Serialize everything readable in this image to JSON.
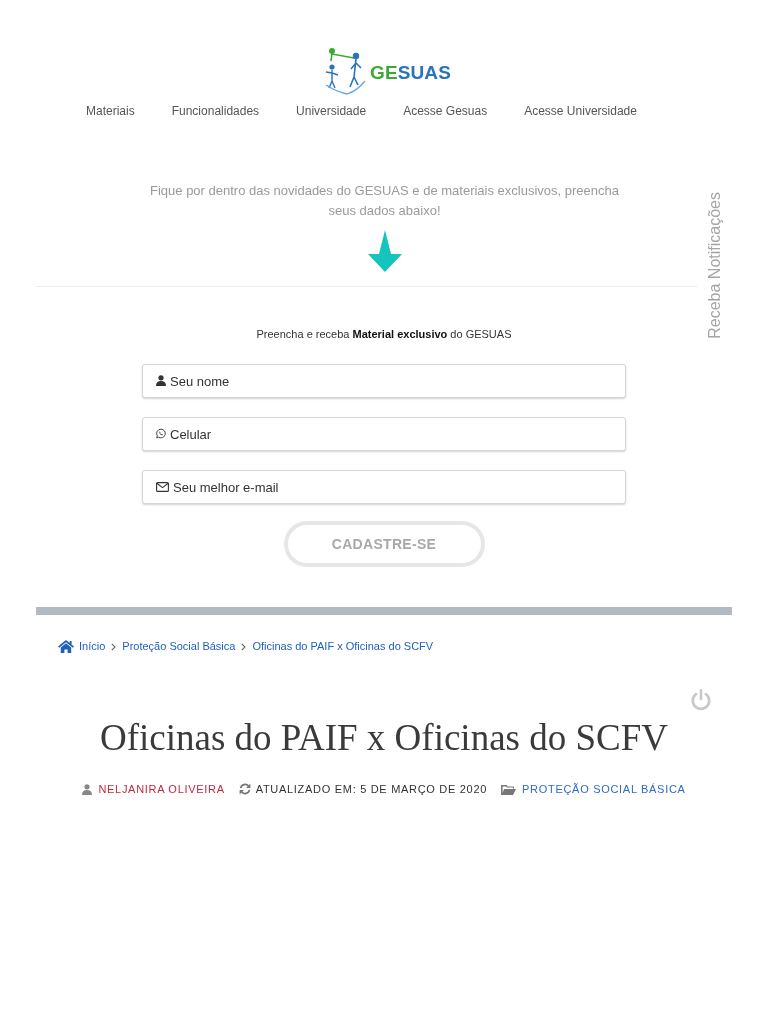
{
  "logo": {
    "parts": [
      {
        "text": "GE",
        "color": "#3aa935"
      },
      {
        "text": "SUAS",
        "color": "#2b74b8"
      }
    ]
  },
  "nav": [
    "Materiais",
    "Funcionalidades",
    "Universidade",
    "Acesse Gesuas",
    "Acesse Universidade"
  ],
  "intro": "Fique por dentro das novidades do GESUAS e de materiais exclusivos, preencha seus dados abaixo!",
  "side_tab": "Receba Notificações",
  "form": {
    "caption": "Preencha e receba **Material exclusivo** do GESUAS",
    "fields": [
      {
        "kind": "name",
        "placeholder": "Seu nome"
      },
      {
        "kind": "phone",
        "placeholder": "Celular"
      },
      {
        "kind": "email",
        "placeholder": "Seu melhor e-mail"
      }
    ],
    "submit": "CADASTRE-SE"
  },
  "breadcrumb": [
    "Início",
    "Proteção Social Básica",
    "Oficinas do PAIF x Oficinas do SCFV"
  ],
  "article": {
    "title": "Oficinas do PAIF x Oficinas do SCFV",
    "author": "NELJANIRA OLIVEIRA",
    "updated": "ATUALIZADO EM: 5 DE MARÇO DE 2020",
    "category": "PROTEÇÃO SOCIAL BÁSICA"
  }
}
